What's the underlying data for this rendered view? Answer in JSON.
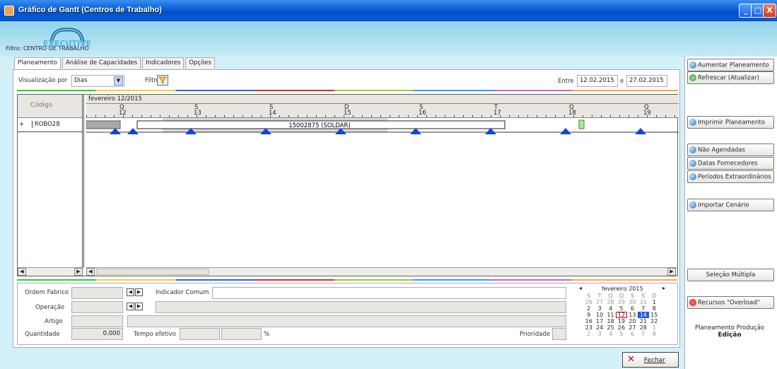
{
  "window": {
    "title": "Gráfico de Gantt (Centros de Trabalho)",
    "minimize": "_",
    "maximize": "□",
    "close": "X"
  },
  "branding": {
    "logo_text": "EXECUTIVE",
    "filter_label": "Filtro: CENTRO DE TRABALHO"
  },
  "tabs": [
    "Planeamento",
    "Análise de Capacidades",
    "Indicadores",
    "Opções"
  ],
  "toolbar": {
    "view_label": "Visualização por",
    "view_value": "Dias",
    "filter_label": "Filtro",
    "range_label": "Entre",
    "date_from": "12.02.2015",
    "range_and": "e",
    "date_to": "27.02.2015"
  },
  "gantt": {
    "code_header": "Código",
    "month_label": "fevereiro 12/2015",
    "days": [
      {
        "letter": "Q",
        "num": "12"
      },
      {
        "letter": "S",
        "num": "13"
      },
      {
        "letter": "S",
        "num": "14"
      },
      {
        "letter": "D",
        "num": "15"
      },
      {
        "letter": "S",
        "num": "16"
      },
      {
        "letter": "T",
        "num": "17"
      },
      {
        "letter": "Q",
        "num": "18"
      },
      {
        "letter": "Q",
        "num": "19"
      }
    ],
    "rows": [
      {
        "expander": "+",
        "code": "ROBO28"
      }
    ],
    "task_label": "15002875 (SOLDAR)"
  },
  "detail": {
    "ordem_label": "Ordem Fabrico",
    "indicador_label": "Indicador Comum",
    "operacao_label": "Operação",
    "artigo_label": "Artigo",
    "quantidade_label": "Quantidade",
    "quantidade_value": "0.000",
    "tempo_label": "Tempo efetivo",
    "percent": "%",
    "prioridade_label": "Prioridade"
  },
  "calendar": {
    "month": "fevereiro 2015",
    "prev": "◂",
    "next": "▸",
    "weekdays": [
      "S",
      "T",
      "Q",
      "Q",
      "S",
      "S",
      "D"
    ],
    "weeks": [
      [
        "26",
        "27",
        "28",
        "29",
        "30",
        "31",
        "1"
      ],
      [
        "2",
        "3",
        "4",
        "5",
        "6",
        "7",
        "8"
      ],
      [
        "9",
        "10",
        "11",
        "12",
        "13",
        "14",
        "15"
      ],
      [
        "16",
        "17",
        "18",
        "19",
        "20",
        "21",
        "22"
      ],
      [
        "23",
        "24",
        "25",
        "26",
        "27",
        "28",
        "1"
      ],
      [
        "2",
        "3",
        "4",
        "5",
        "6",
        "7",
        "8"
      ]
    ],
    "today": "12",
    "selected": "14"
  },
  "sidebar": {
    "aumentar": "Aumentar Planeamento",
    "refrescar": "Refrescar (Atualizar)",
    "imprimir": "Imprimir Planeamento",
    "nao_agendadas": "Não Agendadas",
    "datas_fornecedores": "Datas Fornecedores",
    "periodos": "Períodos Extraordinários",
    "importar": "Importar Cenário",
    "selecao": "Seleção Múltipla",
    "recursos": "Recursos \"Overload\"",
    "planeamento_producao": "Planeamento Produção",
    "edicao": "Edição"
  },
  "footer": {
    "fechar": "Fechar"
  }
}
